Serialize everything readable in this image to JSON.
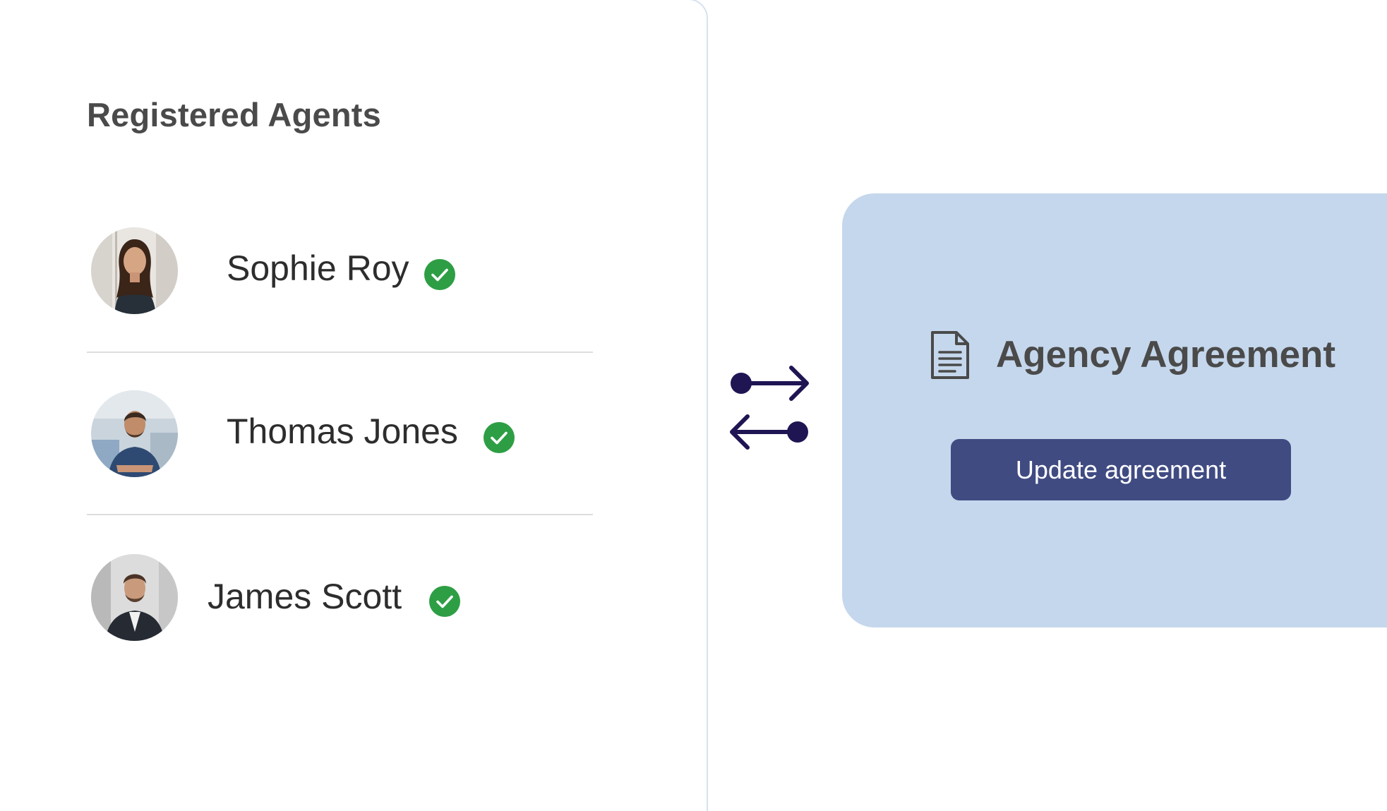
{
  "registered_agents": {
    "title": "Registered Agents",
    "agents": [
      {
        "name": "Sophie Roy",
        "verified": true
      },
      {
        "name": "Thomas Jones",
        "verified": true
      },
      {
        "name": "James Scott",
        "verified": true
      }
    ]
  },
  "agreement": {
    "title": "Agency Agreement",
    "icon": "document-icon",
    "button_label": "Update agreement"
  },
  "icons": {
    "verified": "check-circle-icon",
    "swap": "swap-arrows-icon"
  },
  "colors": {
    "verified_green": "#2e9e45",
    "arrow_navy": "#1f1553",
    "panel_bg": "#c5d7ec",
    "button_bg": "#404b82",
    "card_border": "#d6e2f0"
  }
}
